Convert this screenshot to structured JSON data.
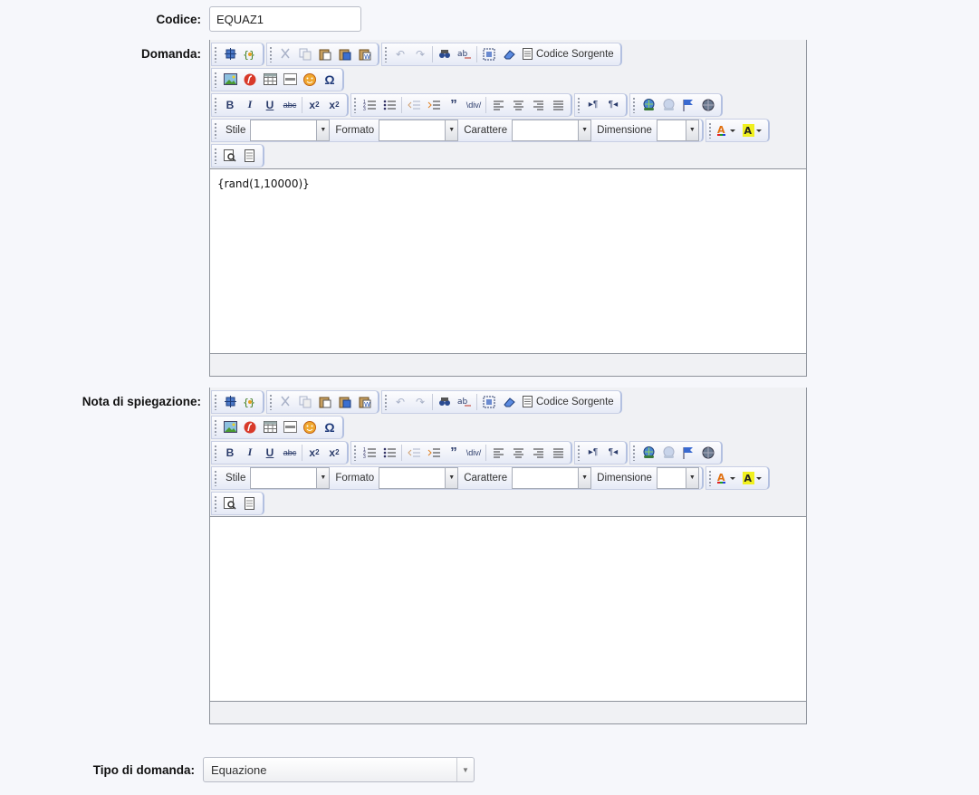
{
  "labels": {
    "codice": "Codice:",
    "domanda": "Domanda:",
    "nota": "Nota di spiegazione:",
    "tipo": "Tipo di domanda:"
  },
  "codice": {
    "value": "EQUAZ1"
  },
  "toolbar": {
    "source_label": "Codice Sorgente",
    "style_label": "Stile",
    "format_label": "Formato",
    "font_label": "Carattere",
    "size_label": "Dimensione",
    "style_value": "",
    "format_value": "",
    "font_value": "",
    "size_value": "",
    "icons": {
      "row1": [
        "preview-icon",
        "templates-icon",
        "cut-icon",
        "copy-icon",
        "paste-icon",
        "paste-text-icon",
        "paste-word-icon",
        "undo-icon",
        "redo-icon",
        "find-icon",
        "replace-icon",
        "select-all-icon",
        "remove-format-icon",
        "source-icon"
      ],
      "row2": [
        "image-icon",
        "flash-icon",
        "table-icon",
        "horizontal-rule-icon",
        "smiley-icon",
        "special-char-icon"
      ],
      "row3": [
        "bold-icon",
        "italic-icon",
        "underline-icon",
        "strike-icon",
        "subscript-icon",
        "superscript-icon",
        "numbered-list-icon",
        "bulleted-list-icon",
        "outdent-icon",
        "indent-icon",
        "blockquote-icon",
        "div-icon",
        "align-left-icon",
        "align-center-icon",
        "align-right-icon",
        "justify-icon",
        "ltr-icon",
        "rtl-icon",
        "link-icon",
        "unlink-icon",
        "anchor-icon",
        "globe-icon"
      ],
      "row4": [
        "text-color-icon",
        "background-color-icon"
      ],
      "row5": [
        "zoom-icon",
        "document-icon"
      ]
    }
  },
  "editors": {
    "domanda": {
      "content": "{rand(1,10000)}"
    },
    "nota": {
      "content": ""
    }
  },
  "tipo": {
    "value": "Equazione"
  },
  "colors": {
    "accent": "#b3c0e0",
    "border": "#8f949c",
    "icon": "#2a3b6a"
  }
}
